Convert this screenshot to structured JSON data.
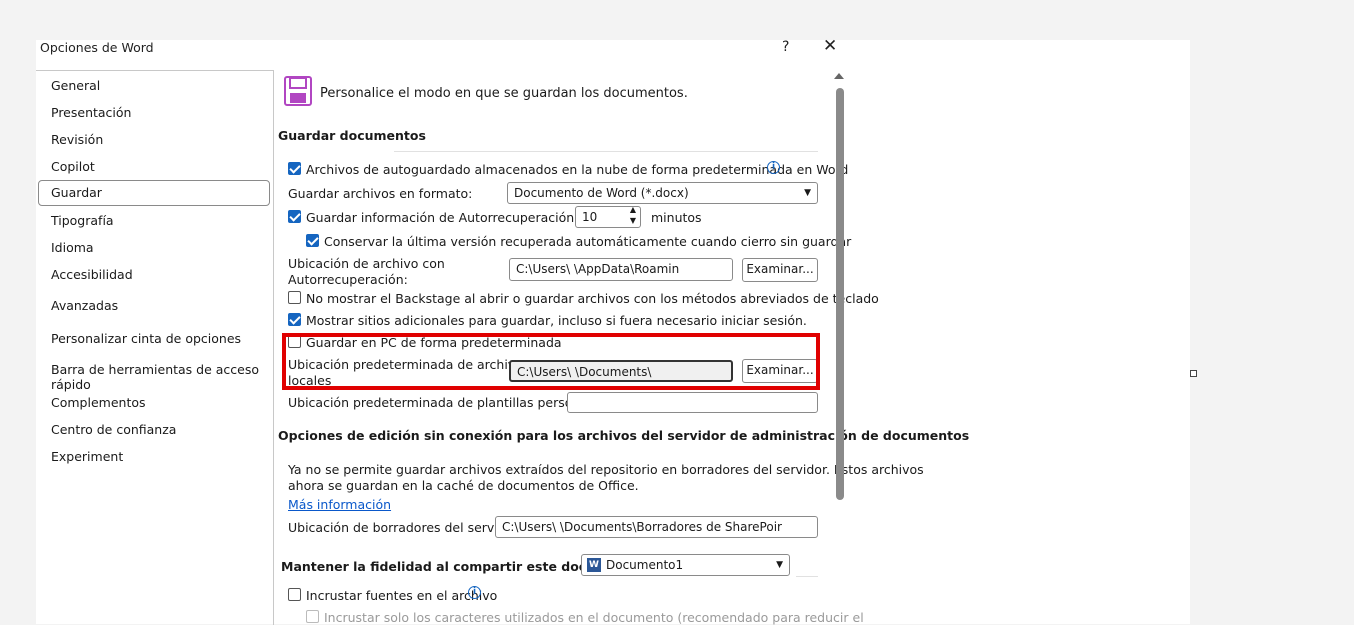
{
  "window": {
    "title": "Opciones de Word",
    "help": "?",
    "close": "✕"
  },
  "sidebar": {
    "items": [
      {
        "label": "General"
      },
      {
        "label": "Presentación"
      },
      {
        "label": "Revisión"
      },
      {
        "label": "Copilot"
      },
      {
        "label": "Guardar"
      },
      {
        "label": "Tipografía"
      },
      {
        "label": "Idioma"
      },
      {
        "label": "Accesibilidad"
      },
      {
        "label": "Avanzadas"
      },
      {
        "label": "Personalizar cinta de opciones"
      },
      {
        "label": "Barra de herramientas de acceso rápido"
      },
      {
        "label": "Complementos"
      },
      {
        "label": "Centro de confianza"
      },
      {
        "label": "Experiment"
      }
    ],
    "selected": "Guardar"
  },
  "header": {
    "text": "Personalice el modo en que se guardan los documentos."
  },
  "save": {
    "section": "Guardar documentos",
    "autosave_label": "Archivos de autoguardado almacenados en la nube de forma predeterminada en Word",
    "format_label": "Guardar archivos en formato:",
    "format_value": "Documento de Word (*.docx)",
    "autorecover_label": "Guardar información de Autorrecuperación cada",
    "autorecover_minutes": "10",
    "minutes_label": "minutos",
    "keep_last_label": "Conservar la última versión recuperada automáticamente cuando cierro sin guardar",
    "autorecover_location_label_1": "Ubicación de archivo con",
    "autorecover_location_label_2": "Autorrecuperación:",
    "autorecover_location_value": "C:\\Users\\          \\AppData\\Roamin",
    "browse": "Examinar...",
    "no_backstage_label": "No mostrar el Backstage al abrir o guardar archivos con los métodos abreviados de teclado",
    "show_more_places_label": "Mostrar sitios adicionales para guardar, incluso si fuera necesario iniciar sesión.",
    "save_to_pc_label": "Guardar en PC de forma predeterminada",
    "local_location_label_1": "Ubicación predeterminada de archivos",
    "local_location_label_2": "locales",
    "local_location_value": "C:\\Users\\          \\Documents\\",
    "templates_label": "Ubicación predeterminada de plantillas personales:",
    "templates_value": ""
  },
  "offline": {
    "section": "Opciones de edición sin conexión para los archivos del servidor de administración de documentos",
    "note_1": "Ya no se permite guardar archivos extraídos del repositorio en borradores del servidor. Estos archivos",
    "note_2": "ahora se guardan en la caché de documentos de Office.",
    "more_info": "Más información",
    "drafts_label": "Ubicación de borradores del servidor:",
    "drafts_value": "C:\\Users\\          \\Documents\\Borradores de SharePoir"
  },
  "fidelity": {
    "section": "Mantener la fidelidad al compartir este documento:",
    "document": "Documento1",
    "embed_fonts_label": "Incrustar fuentes en el archivo",
    "embed_used_label": "Incrustar solo los caracteres utilizados en el documento (recomendado para reducir el"
  },
  "colors": {
    "accent": "#1565c0",
    "highlight": "#e00000",
    "word_purple": "#b146c2"
  },
  "icons": {
    "header": "save-disk-icon",
    "info": "info-icon",
    "document": "word-doc-icon"
  }
}
